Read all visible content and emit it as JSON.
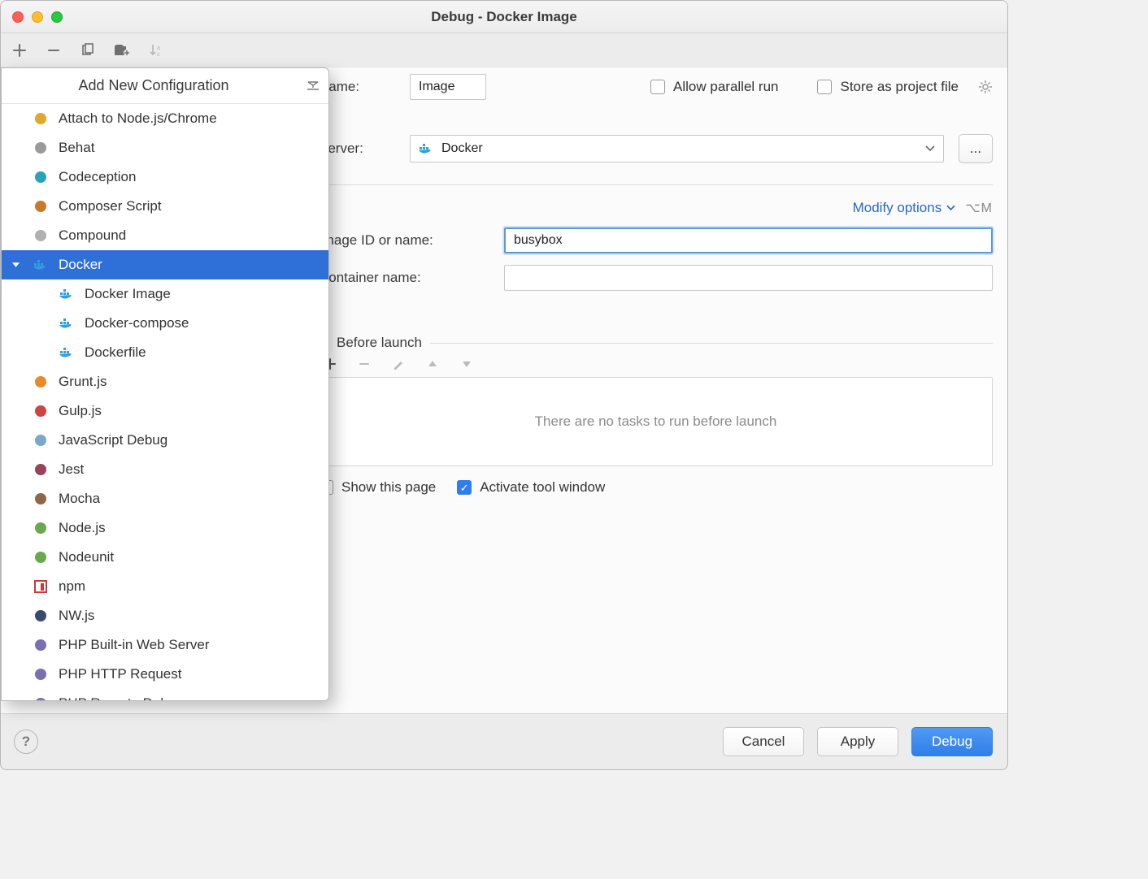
{
  "title": "Debug - Docker Image",
  "toolbar": {
    "add": "+",
    "remove": "−",
    "copy": "copy",
    "templates": "templates",
    "sort": "↓z"
  },
  "form": {
    "name_label": "Name:",
    "name_value": "Image",
    "allow_parallel": "Allow parallel run",
    "store_project": "Store as project file",
    "server_label": "Server:",
    "server_value": "Docker",
    "modify_options": "Modify options",
    "modify_shortcut": "⌥M",
    "image_label": "Image ID or name:",
    "image_value": "busybox",
    "container_label": "Container name:",
    "container_value": "",
    "before_launch_header": "Before launch",
    "no_tasks": "There are no tasks to run before launch",
    "show_this_page": "Show this page",
    "activate_tool": "Activate tool window"
  },
  "buttons": {
    "cancel": "Cancel",
    "apply": "Apply",
    "debug": "Debug"
  },
  "popup": {
    "title": "Add New Configuration",
    "items": [
      {
        "label": "Attach to Node.js/Chrome",
        "icon": "attach-js",
        "color": "#e0a62d"
      },
      {
        "label": "Behat",
        "icon": "behat",
        "color": "#9a9a9a"
      },
      {
        "label": "Codeception",
        "icon": "codeception",
        "color": "#2aa3b8"
      },
      {
        "label": "Composer Script",
        "icon": "composer",
        "color": "#c77a2a"
      },
      {
        "label": "Compound",
        "icon": "compound",
        "color": "#b0b0b0"
      },
      {
        "label": "Docker",
        "icon": "docker",
        "color": "#2e9fe0",
        "selected": true,
        "expandable": true,
        "children": [
          {
            "label": "Docker Image",
            "icon": "docker"
          },
          {
            "label": "Docker-compose",
            "icon": "docker"
          },
          {
            "label": "Dockerfile",
            "icon": "docker"
          }
        ]
      },
      {
        "label": "Grunt.js",
        "icon": "grunt",
        "color": "#e58b2a"
      },
      {
        "label": "Gulp.js",
        "icon": "gulp",
        "color": "#d04343"
      },
      {
        "label": "JavaScript Debug",
        "icon": "jsdebug",
        "color": "#7aa9c7"
      },
      {
        "label": "Jest",
        "icon": "jest",
        "color": "#99425b"
      },
      {
        "label": "Mocha",
        "icon": "mocha",
        "color": "#8d6748"
      },
      {
        "label": "Node.js",
        "icon": "node",
        "color": "#6aa84f"
      },
      {
        "label": "Nodeunit",
        "icon": "nodeunit",
        "color": "#6aa84f"
      },
      {
        "label": "npm",
        "icon": "npm",
        "color": "#cb3837"
      },
      {
        "label": "NW.js",
        "icon": "nwjs",
        "color": "#3a4a6b"
      },
      {
        "label": "PHP Built-in Web Server",
        "icon": "php",
        "color": "#7a6fb0"
      },
      {
        "label": "PHP HTTP Request",
        "icon": "php",
        "color": "#7a6fb0"
      },
      {
        "label": "PHP Remote Debug",
        "icon": "php",
        "color": "#7a6fb0"
      }
    ]
  }
}
